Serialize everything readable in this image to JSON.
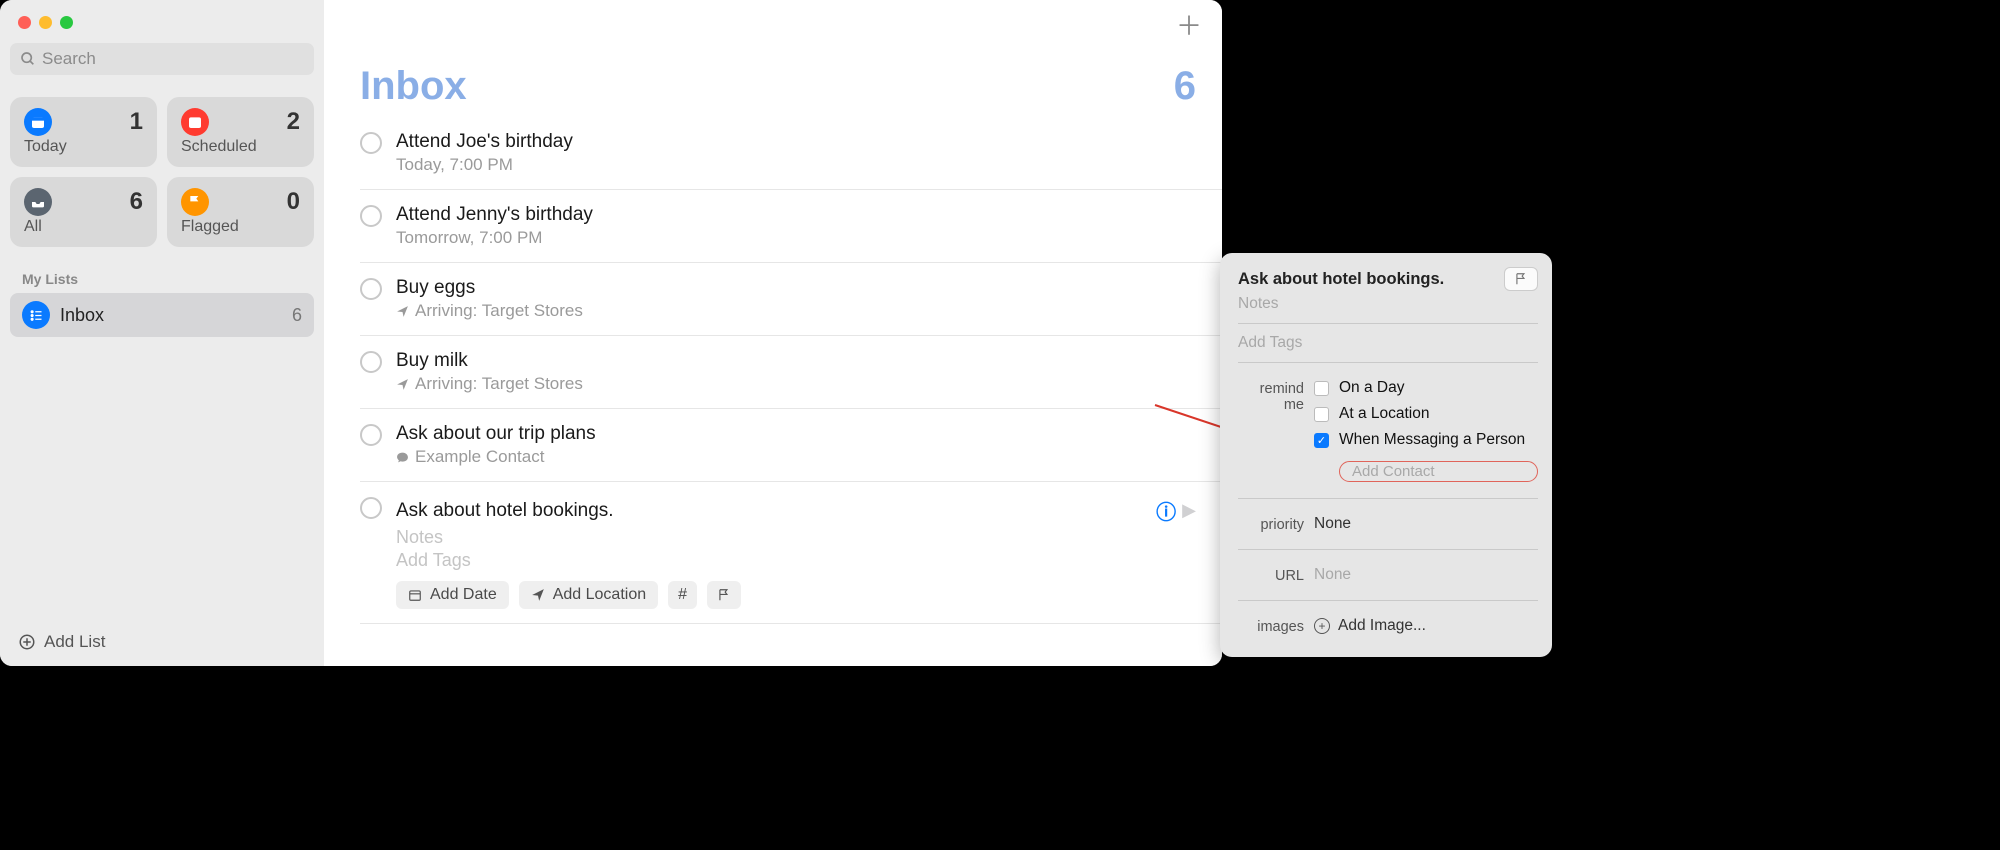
{
  "sidebar": {
    "search_placeholder": "Search",
    "smart": {
      "today": {
        "label": "Today",
        "count": "1"
      },
      "scheduled": {
        "label": "Scheduled",
        "count": "2"
      },
      "all": {
        "label": "All",
        "count": "6"
      },
      "flagged": {
        "label": "Flagged",
        "count": "0"
      }
    },
    "section_header": "My Lists",
    "lists": [
      {
        "label": "Inbox",
        "count": "6"
      }
    ],
    "add_list_label": "Add List"
  },
  "main": {
    "title": "Inbox",
    "count": "6"
  },
  "reminders": [
    {
      "title": "Attend Joe's birthday",
      "subtitle": "Today, 7:00 PM",
      "sub_icon": "none"
    },
    {
      "title": "Attend Jenny's birthday",
      "subtitle": "Tomorrow, 7:00 PM",
      "sub_icon": "none"
    },
    {
      "title": "Buy eggs",
      "subtitle": "Arriving: Target Stores",
      "sub_icon": "location"
    },
    {
      "title": "Buy milk",
      "subtitle": "Arriving: Target Stores",
      "sub_icon": "location"
    },
    {
      "title": "Ask about our trip plans",
      "subtitle": "Example Contact",
      "sub_icon": "chat"
    }
  ],
  "editing_reminder": {
    "title": "Ask about hotel bookings.",
    "notes_placeholder": "Notes",
    "tags_placeholder": "Add Tags",
    "chip_add_date": "Add Date",
    "chip_add_location": "Add Location",
    "chip_tag_symbol": "#"
  },
  "detail": {
    "title": "Ask about hotel bookings.",
    "notes_placeholder": "Notes",
    "tags_placeholder": "Add Tags",
    "remind_label": "remind me",
    "checks": {
      "day": {
        "label": "On a Day",
        "checked": false
      },
      "location": {
        "label": "At a Location",
        "checked": false
      },
      "message": {
        "label": "When Messaging a Person",
        "checked": true
      }
    },
    "add_contact_placeholder": "Add Contact",
    "priority_label": "priority",
    "priority_value": "None",
    "url_label": "URL",
    "url_placeholder": "None",
    "images_label": "images",
    "add_image_label": "Add Image..."
  }
}
